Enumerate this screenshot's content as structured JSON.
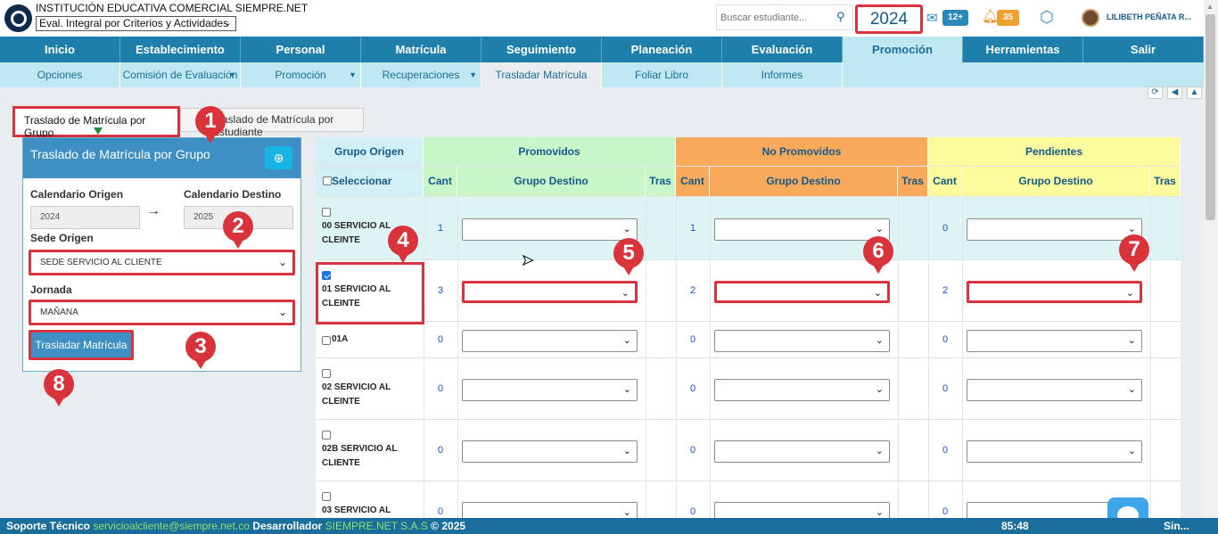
{
  "header": {
    "institution": "INSTITUCIÓN EDUCATIVA COMERCIAL SIEMPRE.NET",
    "module_select": "Eval. Integral por Criterios y Actividades",
    "search_placeholder": "Buscar estudiante...",
    "year": "2024",
    "messages_badge": "12+",
    "alerts_badge": "35",
    "user_name": "LILIBETH PEÑATA R..."
  },
  "nav": [
    "Inicio",
    "Establecimiento",
    "Personal",
    "Matrícula",
    "Seguimiento",
    "Planeación",
    "Evaluación",
    "Promoción",
    "Herramientas",
    "Salir"
  ],
  "nav_active": "Promoción",
  "subnav": [
    {
      "label": "Opciones",
      "dd": ""
    },
    {
      "label": "Comisión de Evaluación",
      "dd": "▼"
    },
    {
      "label": "Promoción",
      "dd": "▼"
    },
    {
      "label": "Recuperaciones",
      "dd": "▼"
    },
    {
      "label": "Trasladar Matrícula",
      "dd": ""
    },
    {
      "label": "Foliar Libro",
      "dd": ""
    },
    {
      "label": "Informes",
      "dd": ""
    }
  ],
  "tabs": {
    "group": "Traslado de Matrícula por Grupo",
    "student": "Traslado de Matrícula por Estudiante"
  },
  "panel": {
    "title": "Traslado de Matrícula por Grupo",
    "cal_origin_label": "Calendario Origen",
    "cal_dest_label": "Calendario Destino",
    "cal_origin": "2024",
    "cal_dest": "2025",
    "sede_label": "Sede Origen",
    "sede_value": "SEDE SERVICIO AL CLIENTE",
    "jornada_label": "Jornada",
    "jornada_value": "MAÑANA",
    "button": "Trasladar Matrícula"
  },
  "table": {
    "group_origin": "Grupo Origen",
    "select_all": "Seleccionar Todos",
    "promoted": "Promovidos",
    "not_promoted": "No Promovidos",
    "pending": "Pendientes",
    "cant": "Cant",
    "dest_group": "Grupo Destino",
    "tras": "Tras",
    "rows": [
      {
        "group": "00 SERVICIO AL CLEINTE",
        "p": "1",
        "n": "1",
        "pe": "0",
        "checked": false
      },
      {
        "group": "01 SERVICIO AL CLEINTE",
        "p": "3",
        "n": "2",
        "pe": "2",
        "checked": true
      },
      {
        "group": "01A",
        "p": "0",
        "n": "0",
        "pe": "0",
        "checked": false
      },
      {
        "group": "02 SERVICIO AL CLEINTE",
        "p": "0",
        "n": "0",
        "pe": "0",
        "checked": false
      },
      {
        "group": "02B SERVICIO AL CLIENTE",
        "p": "0",
        "n": "0",
        "pe": "0",
        "checked": false
      },
      {
        "group": "03 SERVICIO AL",
        "p": "0",
        "n": "0",
        "pe": "0",
        "checked": false
      }
    ]
  },
  "annotations": [
    "1",
    "2",
    "3",
    "4",
    "5",
    "6",
    "7",
    "8"
  ],
  "footer": {
    "support": "Soporte Técnico",
    "email": "servicioalcliente@siempre.net.co",
    "dev": "Desarrollador",
    "company": "SIEMPRE.NET S.A.S",
    "copyright": "© 2025",
    "time": "85:48",
    "brand": "Sin..."
  }
}
